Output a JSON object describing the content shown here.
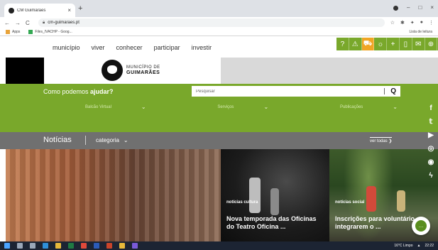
{
  "browser": {
    "tab_title": "CM Guimarães",
    "tab_close": "×",
    "new_tab": "+",
    "url": "cm-guimaraes.pt",
    "nav_back": "←",
    "nav_forward": "→",
    "nav_reload": "C",
    "window_minimize": "–",
    "window_maximize": "□",
    "window_close": "×",
    "bookmarks": [
      {
        "label": "Apps"
      },
      {
        "label": "Files_IVACHP - Goog..."
      }
    ],
    "reading_list": "Lista de leitura"
  },
  "topnav": {
    "links": [
      "município",
      "viver",
      "conhecer",
      "participar",
      "investir"
    ]
  },
  "toolbar_icons": [
    "help-icon",
    "warning-icon",
    "car-icon",
    "sun-icon",
    "plus-icon",
    "phone-icon",
    "mail-icon",
    "globe-icon"
  ],
  "toolbar_glyphs": [
    "?",
    "⚠",
    "⛟",
    "☼",
    "+",
    "▯",
    "✉",
    "⊕"
  ],
  "logo": {
    "small": "MUNICÍPIO DE",
    "big": "GUIMARÃES"
  },
  "search": {
    "help_prefix": "Como podemos ",
    "help_bold": "ajudar?",
    "placeholder": "Pesquisar",
    "icon": "Q"
  },
  "dropdowns": [
    {
      "label": "Balcão Virtual"
    },
    {
      "label": "Serviços"
    },
    {
      "label": "Publicações"
    }
  ],
  "news": {
    "title": "Notícias",
    "category": "categoria",
    "see_all": "ver todas ❯"
  },
  "social": [
    "f",
    "𝕥",
    "▶",
    "◎",
    "◉",
    "ϟ"
  ],
  "cards": [
    {
      "label": "notícias cultura",
      "headline": "Nova temporada das Oficinas do Teatro Oficina ..."
    },
    {
      "label": "notícias social",
      "headline": "Inscrições para voluntário integrarem o ..."
    }
  ],
  "taskbar": {
    "weather": "16°C Limpo",
    "time": "22:22"
  },
  "colors": {
    "brand_green": "#79a82b",
    "news_gray": "#707070",
    "accent_orange": "#f0a524"
  }
}
